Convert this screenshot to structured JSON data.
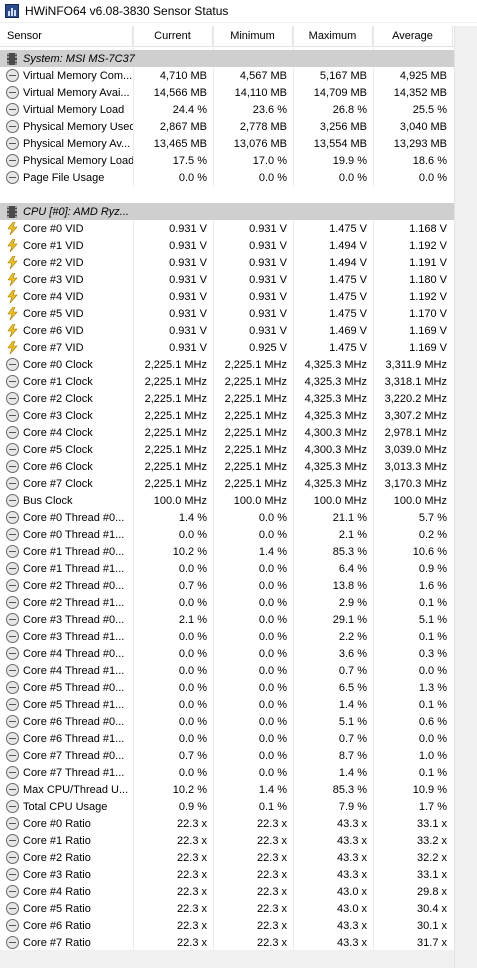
{
  "window": {
    "title": "HWiNFO64 v6.08-3830 Sensor Status"
  },
  "columns": {
    "sensor": "Sensor",
    "current": "Current",
    "minimum": "Minimum",
    "maximum": "Maximum",
    "average": "Average"
  },
  "rows": [
    {
      "type": "group",
      "name": "System: MSI MS-7C37",
      "icon": "chip-icon"
    },
    {
      "type": "sensor",
      "icon": "circle-icon",
      "name": "Virtual Memory Com...",
      "cur": "4,710 MB",
      "min": "4,567 MB",
      "max": "5,167 MB",
      "avg": "4,925 MB"
    },
    {
      "type": "sensor",
      "icon": "circle-icon",
      "name": "Virtual Memory Avai...",
      "cur": "14,566 MB",
      "min": "14,110 MB",
      "max": "14,709 MB",
      "avg": "14,352 MB"
    },
    {
      "type": "sensor",
      "icon": "circle-icon",
      "name": "Virtual Memory Load",
      "cur": "24.4 %",
      "min": "23.6 %",
      "max": "26.8 %",
      "avg": "25.5 %"
    },
    {
      "type": "sensor",
      "icon": "circle-icon",
      "name": "Physical Memory Used",
      "cur": "2,867 MB",
      "min": "2,778 MB",
      "max": "3,256 MB",
      "avg": "3,040 MB"
    },
    {
      "type": "sensor",
      "icon": "circle-icon",
      "name": "Physical Memory Av...",
      "cur": "13,465 MB",
      "min": "13,076 MB",
      "max": "13,554 MB",
      "avg": "13,293 MB"
    },
    {
      "type": "sensor",
      "icon": "circle-icon",
      "name": "Physical Memory Load",
      "cur": "17.5 %",
      "min": "17.0 %",
      "max": "19.9 %",
      "avg": "18.6 %"
    },
    {
      "type": "sensor",
      "icon": "circle-icon",
      "name": "Page File Usage",
      "cur": "0.0 %",
      "min": "0.0 %",
      "max": "0.0 %",
      "avg": "0.0 %"
    },
    {
      "type": "blank"
    },
    {
      "type": "group",
      "name": "CPU [#0]: AMD Ryz...",
      "icon": "chip-icon"
    },
    {
      "type": "sensor",
      "icon": "bolt-icon",
      "name": "Core #0 VID",
      "cur": "0.931 V",
      "min": "0.931 V",
      "max": "1.475 V",
      "avg": "1.168 V"
    },
    {
      "type": "sensor",
      "icon": "bolt-icon",
      "name": "Core #1 VID",
      "cur": "0.931 V",
      "min": "0.931 V",
      "max": "1.494 V",
      "avg": "1.192 V"
    },
    {
      "type": "sensor",
      "icon": "bolt-icon",
      "name": "Core #2 VID",
      "cur": "0.931 V",
      "min": "0.931 V",
      "max": "1.494 V",
      "avg": "1.191 V"
    },
    {
      "type": "sensor",
      "icon": "bolt-icon",
      "name": "Core #3 VID",
      "cur": "0.931 V",
      "min": "0.931 V",
      "max": "1.475 V",
      "avg": "1.180 V"
    },
    {
      "type": "sensor",
      "icon": "bolt-icon",
      "name": "Core #4 VID",
      "cur": "0.931 V",
      "min": "0.931 V",
      "max": "1.475 V",
      "avg": "1.192 V"
    },
    {
      "type": "sensor",
      "icon": "bolt-icon",
      "name": "Core #5 VID",
      "cur": "0.931 V",
      "min": "0.931 V",
      "max": "1.475 V",
      "avg": "1.170 V"
    },
    {
      "type": "sensor",
      "icon": "bolt-icon",
      "name": "Core #6 VID",
      "cur": "0.931 V",
      "min": "0.931 V",
      "max": "1.469 V",
      "avg": "1.169 V"
    },
    {
      "type": "sensor",
      "icon": "bolt-icon",
      "name": "Core #7 VID",
      "cur": "0.931 V",
      "min": "0.925 V",
      "max": "1.475 V",
      "avg": "1.169 V"
    },
    {
      "type": "sensor",
      "icon": "circle-icon",
      "name": "Core #0 Clock",
      "cur": "2,225.1 MHz",
      "min": "2,225.1 MHz",
      "max": "4,325.3 MHz",
      "avg": "3,311.9 MHz"
    },
    {
      "type": "sensor",
      "icon": "circle-icon",
      "name": "Core #1 Clock",
      "cur": "2,225.1 MHz",
      "min": "2,225.1 MHz",
      "max": "4,325.3 MHz",
      "avg": "3,318.1 MHz"
    },
    {
      "type": "sensor",
      "icon": "circle-icon",
      "name": "Core #2 Clock",
      "cur": "2,225.1 MHz",
      "min": "2,225.1 MHz",
      "max": "4,325.3 MHz",
      "avg": "3,220.2 MHz"
    },
    {
      "type": "sensor",
      "icon": "circle-icon",
      "name": "Core #3 Clock",
      "cur": "2,225.1 MHz",
      "min": "2,225.1 MHz",
      "max": "4,325.3 MHz",
      "avg": "3,307.2 MHz"
    },
    {
      "type": "sensor",
      "icon": "circle-icon",
      "name": "Core #4 Clock",
      "cur": "2,225.1 MHz",
      "min": "2,225.1 MHz",
      "max": "4,300.3 MHz",
      "avg": "2,978.1 MHz"
    },
    {
      "type": "sensor",
      "icon": "circle-icon",
      "name": "Core #5 Clock",
      "cur": "2,225.1 MHz",
      "min": "2,225.1 MHz",
      "max": "4,300.3 MHz",
      "avg": "3,039.0 MHz"
    },
    {
      "type": "sensor",
      "icon": "circle-icon",
      "name": "Core #6 Clock",
      "cur": "2,225.1 MHz",
      "min": "2,225.1 MHz",
      "max": "4,325.3 MHz",
      "avg": "3,013.3 MHz"
    },
    {
      "type": "sensor",
      "icon": "circle-icon",
      "name": "Core #7 Clock",
      "cur": "2,225.1 MHz",
      "min": "2,225.1 MHz",
      "max": "4,325.3 MHz",
      "avg": "3,170.3 MHz"
    },
    {
      "type": "sensor",
      "icon": "circle-icon",
      "name": "Bus Clock",
      "cur": "100.0 MHz",
      "min": "100.0 MHz",
      "max": "100.0 MHz",
      "avg": "100.0 MHz"
    },
    {
      "type": "sensor",
      "icon": "circle-icon",
      "name": "Core #0 Thread #0...",
      "cur": "1.4 %",
      "min": "0.0 %",
      "max": "21.1 %",
      "avg": "5.7 %"
    },
    {
      "type": "sensor",
      "icon": "circle-icon",
      "name": "Core #0 Thread #1...",
      "cur": "0.0 %",
      "min": "0.0 %",
      "max": "2.1 %",
      "avg": "0.2 %"
    },
    {
      "type": "sensor",
      "icon": "circle-icon",
      "name": "Core #1 Thread #0...",
      "cur": "10.2 %",
      "min": "1.4 %",
      "max": "85.3 %",
      "avg": "10.6 %"
    },
    {
      "type": "sensor",
      "icon": "circle-icon",
      "name": "Core #1 Thread #1...",
      "cur": "0.0 %",
      "min": "0.0 %",
      "max": "6.4 %",
      "avg": "0.9 %"
    },
    {
      "type": "sensor",
      "icon": "circle-icon",
      "name": "Core #2 Thread #0...",
      "cur": "0.7 %",
      "min": "0.0 %",
      "max": "13.8 %",
      "avg": "1.6 %"
    },
    {
      "type": "sensor",
      "icon": "circle-icon",
      "name": "Core #2 Thread #1...",
      "cur": "0.0 %",
      "min": "0.0 %",
      "max": "2.9 %",
      "avg": "0.1 %"
    },
    {
      "type": "sensor",
      "icon": "circle-icon",
      "name": "Core #3 Thread #0...",
      "cur": "2.1 %",
      "min": "0.0 %",
      "max": "29.1 %",
      "avg": "5.1 %"
    },
    {
      "type": "sensor",
      "icon": "circle-icon",
      "name": "Core #3 Thread #1...",
      "cur": "0.0 %",
      "min": "0.0 %",
      "max": "2.2 %",
      "avg": "0.1 %"
    },
    {
      "type": "sensor",
      "icon": "circle-icon",
      "name": "Core #4 Thread #0...",
      "cur": "0.0 %",
      "min": "0.0 %",
      "max": "3.6 %",
      "avg": "0.3 %"
    },
    {
      "type": "sensor",
      "icon": "circle-icon",
      "name": "Core #4 Thread #1...",
      "cur": "0.0 %",
      "min": "0.0 %",
      "max": "0.7 %",
      "avg": "0.0 %"
    },
    {
      "type": "sensor",
      "icon": "circle-icon",
      "name": "Core #5 Thread #0...",
      "cur": "0.0 %",
      "min": "0.0 %",
      "max": "6.5 %",
      "avg": "1.3 %"
    },
    {
      "type": "sensor",
      "icon": "circle-icon",
      "name": "Core #5 Thread #1...",
      "cur": "0.0 %",
      "min": "0.0 %",
      "max": "1.4 %",
      "avg": "0.1 %"
    },
    {
      "type": "sensor",
      "icon": "circle-icon",
      "name": "Core #6 Thread #0...",
      "cur": "0.0 %",
      "min": "0.0 %",
      "max": "5.1 %",
      "avg": "0.6 %"
    },
    {
      "type": "sensor",
      "icon": "circle-icon",
      "name": "Core #6 Thread #1...",
      "cur": "0.0 %",
      "min": "0.0 %",
      "max": "0.7 %",
      "avg": "0.0 %"
    },
    {
      "type": "sensor",
      "icon": "circle-icon",
      "name": "Core #7 Thread #0...",
      "cur": "0.7 %",
      "min": "0.0 %",
      "max": "8.7 %",
      "avg": "1.0 %"
    },
    {
      "type": "sensor",
      "icon": "circle-icon",
      "name": "Core #7 Thread #1...",
      "cur": "0.0 %",
      "min": "0.0 %",
      "max": "1.4 %",
      "avg": "0.1 %"
    },
    {
      "type": "sensor",
      "icon": "circle-icon",
      "name": "Max CPU/Thread U...",
      "cur": "10.2 %",
      "min": "1.4 %",
      "max": "85.3 %",
      "avg": "10.9 %"
    },
    {
      "type": "sensor",
      "icon": "circle-icon",
      "name": "Total CPU Usage",
      "cur": "0.9 %",
      "min": "0.1 %",
      "max": "7.9 %",
      "avg": "1.7 %"
    },
    {
      "type": "sensor",
      "icon": "circle-icon",
      "name": "Core #0 Ratio",
      "cur": "22.3 x",
      "min": "22.3 x",
      "max": "43.3 x",
      "avg": "33.1 x"
    },
    {
      "type": "sensor",
      "icon": "circle-icon",
      "name": "Core #1 Ratio",
      "cur": "22.3 x",
      "min": "22.3 x",
      "max": "43.3 x",
      "avg": "33.2 x"
    },
    {
      "type": "sensor",
      "icon": "circle-icon",
      "name": "Core #2 Ratio",
      "cur": "22.3 x",
      "min": "22.3 x",
      "max": "43.3 x",
      "avg": "32.2 x"
    },
    {
      "type": "sensor",
      "icon": "circle-icon",
      "name": "Core #3 Ratio",
      "cur": "22.3 x",
      "min": "22.3 x",
      "max": "43.3 x",
      "avg": "33.1 x"
    },
    {
      "type": "sensor",
      "icon": "circle-icon",
      "name": "Core #4 Ratio",
      "cur": "22.3 x",
      "min": "22.3 x",
      "max": "43.0 x",
      "avg": "29.8 x"
    },
    {
      "type": "sensor",
      "icon": "circle-icon",
      "name": "Core #5 Ratio",
      "cur": "22.3 x",
      "min": "22.3 x",
      "max": "43.0 x",
      "avg": "30.4 x"
    },
    {
      "type": "sensor",
      "icon": "circle-icon",
      "name": "Core #6 Ratio",
      "cur": "22.3 x",
      "min": "22.3 x",
      "max": "43.3 x",
      "avg": "30.1 x"
    },
    {
      "type": "sensor",
      "icon": "circle-icon",
      "name": "Core #7 Ratio",
      "cur": "22.3 x",
      "min": "22.3 x",
      "max": "43.3 x",
      "avg": "31.7 x"
    }
  ]
}
